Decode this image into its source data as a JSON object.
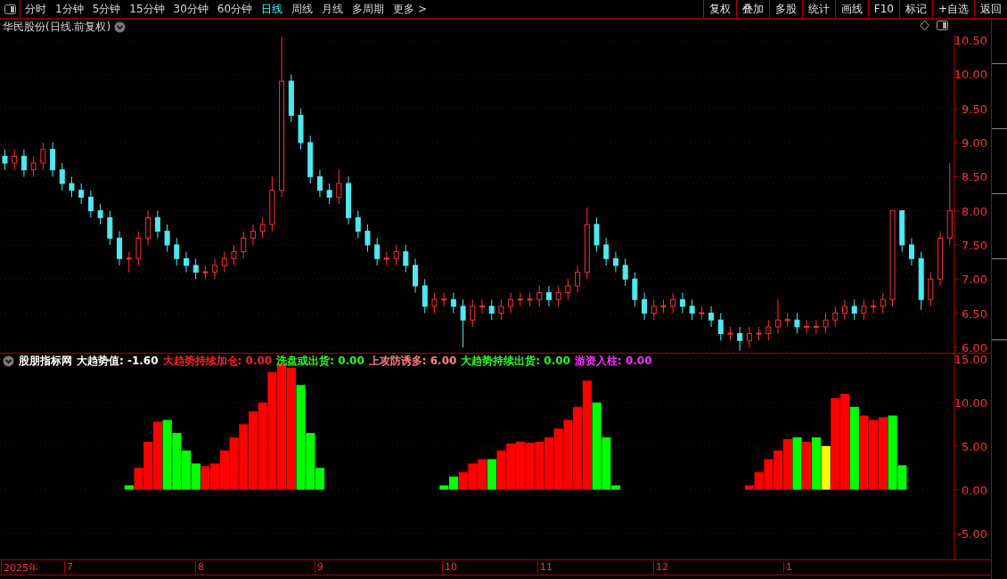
{
  "toolbar": {
    "periods": [
      {
        "label": "分时",
        "selected": false
      },
      {
        "label": "1分钟",
        "selected": false
      },
      {
        "label": "5分钟",
        "selected": false
      },
      {
        "label": "15分钟",
        "selected": false
      },
      {
        "label": "30分钟",
        "selected": false
      },
      {
        "label": "60分钟",
        "selected": false
      },
      {
        "label": "日线",
        "selected": true
      },
      {
        "label": "周线",
        "selected": false
      },
      {
        "label": "月线",
        "selected": false
      },
      {
        "label": "多周期",
        "selected": false
      },
      {
        "label": "更多 >",
        "selected": false
      }
    ],
    "actions": [
      "复权",
      "叠加",
      "多股",
      "统计",
      "画线",
      "F10",
      "标记",
      "+自选",
      "返回"
    ]
  },
  "price_panel": {
    "title": "华民股份(日线.前复权)",
    "chart_data": {
      "type": "candlestick",
      "grid": true,
      "ylim": [
        5.92,
        10.58
      ],
      "yticks": [
        {
          "value": 10.5,
          "label": "10.50"
        },
        {
          "value": 10,
          "label": "10.00"
        },
        {
          "value": 9.5,
          "label": "9.50"
        },
        {
          "value": 9,
          "label": "9.00"
        },
        {
          "value": 8.5,
          "label": "8.50"
        },
        {
          "value": 8,
          "label": "8.00"
        },
        {
          "value": 7.5,
          "label": "7.50"
        },
        {
          "value": 7,
          "label": "7.00"
        },
        {
          "value": 6.5,
          "label": "6.50"
        },
        {
          "value": 6,
          "label": "6.00"
        }
      ],
      "ohlc": [
        [
          8.8,
          8.9,
          8.6,
          8.7
        ],
        [
          8.7,
          8.9,
          8.6,
          8.8
        ],
        [
          8.8,
          8.9,
          8.5,
          8.6
        ],
        [
          8.6,
          8.8,
          8.5,
          8.7
        ],
        [
          8.7,
          9.0,
          8.6,
          8.9
        ],
        [
          8.9,
          9.0,
          8.5,
          8.6
        ],
        [
          8.6,
          8.7,
          8.3,
          8.4
        ],
        [
          8.4,
          8.5,
          8.2,
          8.3
        ],
        [
          8.3,
          8.4,
          8.1,
          8.2
        ],
        [
          8.2,
          8.3,
          7.9,
          8.0
        ],
        [
          8.0,
          8.1,
          7.8,
          7.9
        ],
        [
          7.9,
          8.0,
          7.5,
          7.6
        ],
        [
          7.6,
          7.7,
          7.2,
          7.3
        ],
        [
          7.3,
          7.4,
          7.1,
          7.3
        ],
        [
          7.3,
          7.7,
          7.2,
          7.6
        ],
        [
          7.6,
          8.0,
          7.5,
          7.9
        ],
        [
          7.9,
          8.0,
          7.6,
          7.7
        ],
        [
          7.7,
          7.8,
          7.4,
          7.5
        ],
        [
          7.5,
          7.6,
          7.2,
          7.3
        ],
        [
          7.3,
          7.4,
          7.1,
          7.2
        ],
        [
          7.2,
          7.3,
          7.0,
          7.1
        ],
        [
          7.1,
          7.2,
          7.0,
          7.1
        ],
        [
          7.1,
          7.3,
          7.0,
          7.2
        ],
        [
          7.2,
          7.4,
          7.1,
          7.3
        ],
        [
          7.3,
          7.5,
          7.2,
          7.4
        ],
        [
          7.4,
          7.7,
          7.3,
          7.6
        ],
        [
          7.6,
          7.8,
          7.5,
          7.7
        ],
        [
          7.7,
          7.9,
          7.6,
          7.8
        ],
        [
          7.8,
          8.5,
          7.7,
          8.3
        ],
        [
          8.3,
          10.55,
          8.2,
          9.9
        ],
        [
          9.9,
          10.0,
          9.3,
          9.4
        ],
        [
          9.4,
          9.5,
          8.9,
          9.0
        ],
        [
          9.0,
          9.1,
          8.4,
          8.5
        ],
        [
          8.5,
          8.6,
          8.2,
          8.3
        ],
        [
          8.3,
          8.4,
          8.1,
          8.2
        ],
        [
          8.2,
          8.6,
          8.1,
          8.4
        ],
        [
          8.4,
          8.5,
          7.8,
          7.9
        ],
        [
          7.9,
          8.0,
          7.6,
          7.7
        ],
        [
          7.7,
          7.8,
          7.4,
          7.5
        ],
        [
          7.5,
          7.6,
          7.2,
          7.3
        ],
        [
          7.3,
          7.4,
          7.2,
          7.3
        ],
        [
          7.3,
          7.5,
          7.2,
          7.4
        ],
        [
          7.4,
          7.5,
          7.1,
          7.2
        ],
        [
          7.2,
          7.3,
          6.8,
          6.9
        ],
        [
          6.9,
          7.0,
          6.5,
          6.6
        ],
        [
          6.6,
          6.8,
          6.5,
          6.7
        ],
        [
          6.7,
          6.8,
          6.6,
          6.7
        ],
        [
          6.7,
          6.8,
          6.5,
          6.6
        ],
        [
          6.6,
          6.7,
          6.0,
          6.4
        ],
        [
          6.4,
          6.7,
          6.3,
          6.6
        ],
        [
          6.6,
          6.7,
          6.5,
          6.6
        ],
        [
          6.6,
          6.7,
          6.4,
          6.5
        ],
        [
          6.5,
          6.7,
          6.4,
          6.6
        ],
        [
          6.6,
          6.8,
          6.5,
          6.7
        ],
        [
          6.7,
          6.8,
          6.6,
          6.7
        ],
        [
          6.7,
          6.8,
          6.6,
          6.7
        ],
        [
          6.7,
          6.9,
          6.6,
          6.8
        ],
        [
          6.8,
          6.9,
          6.6,
          6.7
        ],
        [
          6.7,
          6.9,
          6.6,
          6.8
        ],
        [
          6.8,
          7.0,
          6.7,
          6.9
        ],
        [
          6.9,
          7.2,
          6.8,
          7.1
        ],
        [
          7.1,
          8.05,
          7.0,
          7.8
        ],
        [
          7.8,
          7.9,
          7.4,
          7.5
        ],
        [
          7.5,
          7.6,
          7.2,
          7.3
        ],
        [
          7.3,
          7.4,
          7.1,
          7.2
        ],
        [
          7.2,
          7.3,
          6.9,
          7.0
        ],
        [
          7.0,
          7.1,
          6.6,
          6.7
        ],
        [
          6.7,
          6.8,
          6.4,
          6.5
        ],
        [
          6.5,
          6.7,
          6.4,
          6.6
        ],
        [
          6.6,
          6.7,
          6.5,
          6.6
        ],
        [
          6.6,
          6.8,
          6.5,
          6.7
        ],
        [
          6.7,
          6.8,
          6.5,
          6.6
        ],
        [
          6.6,
          6.7,
          6.4,
          6.5
        ],
        [
          6.5,
          6.6,
          6.4,
          6.5
        ],
        [
          6.5,
          6.6,
          6.3,
          6.4
        ],
        [
          6.4,
          6.5,
          6.1,
          6.2
        ],
        [
          6.2,
          6.3,
          6.1,
          6.2
        ],
        [
          6.2,
          6.3,
          5.95,
          6.1
        ],
        [
          6.1,
          6.3,
          6.0,
          6.2
        ],
        [
          6.2,
          6.3,
          6.1,
          6.2
        ],
        [
          6.2,
          6.4,
          6.1,
          6.3
        ],
        [
          6.3,
          6.7,
          6.2,
          6.4
        ],
        [
          6.4,
          6.5,
          6.3,
          6.4
        ],
        [
          6.4,
          6.5,
          6.2,
          6.3
        ],
        [
          6.3,
          6.4,
          6.2,
          6.3
        ],
        [
          6.3,
          6.4,
          6.2,
          6.3
        ],
        [
          6.3,
          6.5,
          6.2,
          6.4
        ],
        [
          6.4,
          6.6,
          6.3,
          6.5
        ],
        [
          6.5,
          6.7,
          6.4,
          6.6
        ],
        [
          6.6,
          6.7,
          6.4,
          6.5
        ],
        [
          6.5,
          6.7,
          6.4,
          6.6
        ],
        [
          6.6,
          6.7,
          6.5,
          6.6
        ],
        [
          6.6,
          6.8,
          6.5,
          6.7
        ],
        [
          6.7,
          8.0,
          6.6,
          8.0
        ],
        [
          8.0,
          8.0,
          7.4,
          7.5
        ],
        [
          7.5,
          7.6,
          7.2,
          7.3
        ],
        [
          7.3,
          7.4,
          6.55,
          6.7
        ],
        [
          6.7,
          7.1,
          6.6,
          7.0
        ],
        [
          7.0,
          7.7,
          6.9,
          7.6
        ],
        [
          7.6,
          8.7,
          7.5,
          8.0
        ]
      ]
    }
  },
  "indicator_panel": {
    "legend": [
      {
        "text": "股朋指标网",
        "color": "#ffffff"
      },
      {
        "text": "大趋势值: -1.60",
        "color": "#ffffff"
      },
      {
        "text": "大趋势持续加仓: 0.00",
        "color": "#ff2020"
      },
      {
        "text": "洗盘或出货: 0.00",
        "color": "#20ff20"
      },
      {
        "text": "上攻防诱多: 6.00",
        "color": "#ff8080"
      },
      {
        "text": "大趋势持续出货: 0.00",
        "color": "#20ff20"
      },
      {
        "text": "游资入柱: 0.00",
        "color": "#ff30ff"
      }
    ],
    "chart_data": {
      "type": "bar",
      "grid": true,
      "ylim": [
        -8,
        15.6
      ],
      "yticks": [
        {
          "value": 15,
          "label": "15.00"
        },
        {
          "value": 10,
          "label": "10.00"
        },
        {
          "value": 5,
          "label": "5.00"
        },
        {
          "value": 0,
          "label": "0.00"
        },
        {
          "value": -5,
          "label": "-5.00"
        }
      ],
      "series": [
        {
          "color": "#ff0000",
          "values": [
            null,
            null,
            null,
            null,
            null,
            null,
            null,
            null,
            null,
            null,
            null,
            null,
            null,
            null,
            2.5,
            5.5,
            7.8,
            null,
            null,
            null,
            null,
            2.7,
            3,
            4.5,
            6,
            7.5,
            9,
            10,
            13.5,
            14.5,
            14,
            null,
            null,
            null,
            null,
            null,
            null,
            null,
            null,
            null,
            null,
            null,
            null,
            null,
            null,
            null,
            null,
            null,
            2,
            3,
            3.5,
            null,
            4.5,
            5.3,
            5.5,
            5.4,
            5.5,
            6,
            7,
            8,
            9.5,
            12.5,
            null,
            null,
            null,
            null,
            null,
            null,
            null,
            null,
            null,
            null,
            null,
            null,
            null,
            null,
            null,
            null,
            0.5,
            2,
            3.5,
            4.5,
            5.8,
            null,
            5.5,
            null,
            null,
            10.5,
            11,
            null,
            8.5,
            8,
            8.3,
            null,
            null,
            null,
            null,
            null,
            null,
            null
          ]
        },
        {
          "color": "#00ff00",
          "values": [
            null,
            null,
            null,
            null,
            null,
            null,
            null,
            null,
            null,
            null,
            null,
            null,
            null,
            0.5,
            null,
            null,
            null,
            8,
            6.5,
            4.5,
            3,
            null,
            null,
            null,
            null,
            null,
            null,
            null,
            null,
            null,
            null,
            12,
            6.5,
            2.5,
            null,
            null,
            null,
            null,
            null,
            null,
            null,
            null,
            null,
            null,
            null,
            null,
            0.5,
            1.5,
            null,
            null,
            null,
            3.5,
            null,
            null,
            null,
            null,
            null,
            null,
            null,
            null,
            null,
            null,
            10,
            6,
            0.5,
            null,
            null,
            null,
            null,
            null,
            null,
            null,
            null,
            null,
            null,
            null,
            null,
            null,
            null,
            null,
            null,
            null,
            null,
            6,
            null,
            6,
            null,
            null,
            null,
            9.5,
            null,
            null,
            null,
            8.5,
            2.8,
            null,
            null,
            null,
            null,
            null
          ]
        },
        {
          "color": "#ffff00",
          "values": [
            null,
            null,
            null,
            null,
            null,
            null,
            null,
            null,
            null,
            null,
            null,
            null,
            null,
            null,
            null,
            null,
            null,
            null,
            null,
            null,
            null,
            null,
            null,
            null,
            null,
            null,
            null,
            null,
            null,
            null,
            null,
            null,
            null,
            null,
            null,
            null,
            null,
            null,
            null,
            null,
            null,
            null,
            null,
            null,
            null,
            null,
            null,
            null,
            null,
            null,
            null,
            null,
            null,
            null,
            null,
            null,
            null,
            null,
            null,
            null,
            null,
            null,
            null,
            null,
            null,
            null,
            null,
            null,
            null,
            null,
            null,
            null,
            null,
            null,
            null,
            null,
            null,
            null,
            null,
            null,
            null,
            null,
            null,
            null,
            null,
            null,
            5,
            null,
            null,
            null,
            null,
            null,
            null,
            null,
            null,
            null,
            null,
            null,
            null,
            null
          ]
        }
      ]
    }
  },
  "date_axis": [
    "2025年",
    "7",
    "8",
    "9",
    "10",
    "11",
    "12",
    "1"
  ]
}
